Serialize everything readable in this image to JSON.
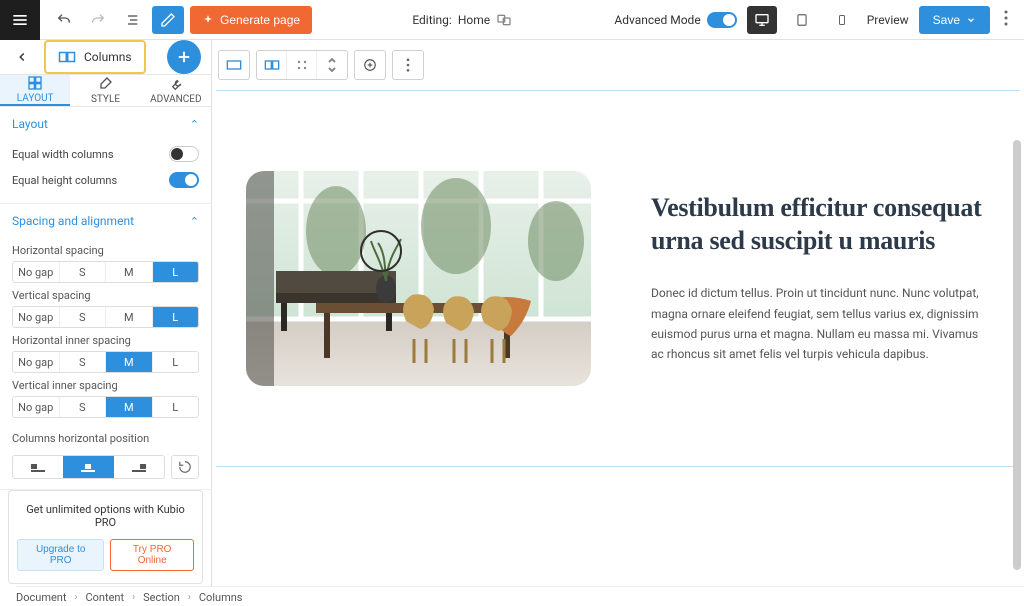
{
  "topbar": {
    "generate_label": "Generate page",
    "editing_prefix": "Editing:",
    "editing_page": "Home",
    "advanced_mode": "Advanced Mode",
    "preview": "Preview",
    "save": "Save"
  },
  "sidebar": {
    "chip_label": "Columns",
    "tabs": {
      "layout": "LAYOUT",
      "style": "STYLE",
      "advanced": "ADVANCED"
    },
    "panel_layout": "Layout",
    "equal_width": "Equal width columns",
    "equal_height": "Equal height columns",
    "panel_spacing": "Spacing and alignment",
    "h_spacing": "Horizontal spacing",
    "v_spacing": "Vertical spacing",
    "h_inner": "Horizontal inner spacing",
    "v_inner": "Vertical inner spacing",
    "cols_pos": "Columns horizontal position",
    "seg_options": {
      "nogap": "No gap",
      "s": "S",
      "m": "M",
      "l": "L"
    }
  },
  "pro": {
    "title": "Get unlimited options with Kubio PRO",
    "upgrade": "Upgrade to PRO",
    "try": "Try PRO Online"
  },
  "breadcrumb": [
    "Document",
    "Content",
    "Section",
    "Columns"
  ],
  "content": {
    "heading": "Vestibulum efficitur consequat urna sed suscipit u mauris",
    "paragraph": "Donec id dictum tellus. Proin ut tincidunt nunc. Nunc volutpat, magna ornare eleifend feugiat, sem tellus varius ex, dignissim euismod purus urna et magna. Nullam eu massa mi. Vivamus ac rhoncus sit amet felis vel turpis vehicula dapibus."
  }
}
